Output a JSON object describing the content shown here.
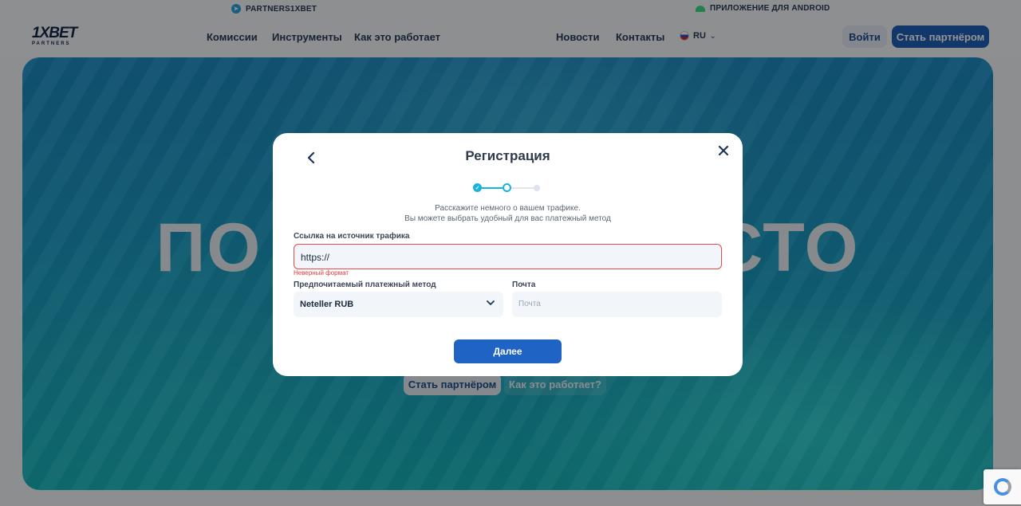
{
  "topbar": {
    "telegram_label": "PARTNERS1XBET",
    "android_label": "ПРИЛОЖЕНИЕ ДЛЯ ANDROID"
  },
  "header": {
    "logo": "1XBET",
    "logo_sub": "PARTNERS",
    "nav": [
      "Комиссии",
      "Инструменты",
      "Как это работает",
      "Новости",
      "Контакты"
    ],
    "lang": "RU",
    "login": "Войти",
    "become_partner": "Стать партнёром"
  },
  "hero": {
    "title_left": "ПО",
    "title_right": "СТО",
    "cta_primary": "Стать партнёром",
    "cta_secondary": "Как это работает?"
  },
  "modal": {
    "title": "Регистрация",
    "subtitle_line1": "Расскажите немного о вашем трафике.",
    "subtitle_line2": "Вы можете выбрать удобный для вас платежный метод",
    "steps_total": 3,
    "current_step": 2,
    "traffic_label": "Ссылка на источник трафика",
    "traffic_value": "https://",
    "traffic_error": "Неверный формат",
    "payment_label": "Предпочитаемый платежный метод",
    "payment_value": "Neteller RUB",
    "email_label": "Почта",
    "email_placeholder": "Почта",
    "next_button": "Далее"
  },
  "colors": {
    "primary": "#1f63c4",
    "accent": "#19b3d9",
    "error": "#e8494d"
  }
}
